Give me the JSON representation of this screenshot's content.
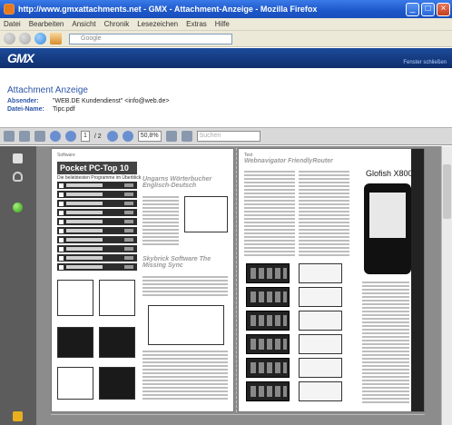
{
  "window": {
    "title": "http://www.gmxattachments.net - GMX - Attachment-Anzeige - Mozilla Firefox",
    "minimize": "_",
    "maximize": "□",
    "close": "×"
  },
  "menu": [
    "Datei",
    "Bearbeiten",
    "Ansicht",
    "Chronik",
    "Lesezeichen",
    "Extras",
    "Hilfe"
  ],
  "navbar": {
    "url_placeholder": "Google"
  },
  "gmx": {
    "logo": "GMX",
    "logout": "Fenster schließen"
  },
  "attachment": {
    "heading": "Attachment Anzeige",
    "sender_label": "Absender:",
    "sender_value": "\"WEB.DE Kundendienst\" <info@web.de>",
    "file_label": "Datei-Name:",
    "file_value": "Tipc.pdf"
  },
  "pdf_toolbar": {
    "page_current": "1",
    "page_total": "/ 2",
    "zoom": "50,8%",
    "search_placeholder": "Suchen"
  },
  "doc": {
    "left_page": {
      "header": "Software",
      "title": "Pocket PC-Top 10",
      "subtitle": "Die beliebtesten Programme im Überblick",
      "col2_heading": "Ungarns Wörterbucher Englisch-Deutsch",
      "col2_heading2": "Skybrick Software The Missing Sync"
    },
    "right_page": {
      "header": "Test",
      "col1_heading": "Webnavigator FriendlyRouter",
      "product": "Glofish X800"
    }
  },
  "colors": {
    "titlebar": "#1d56c8",
    "gmx_bar": "#163f86",
    "heading_blue": "#2b55a7",
    "doc_bg": "#8c8c8c"
  }
}
